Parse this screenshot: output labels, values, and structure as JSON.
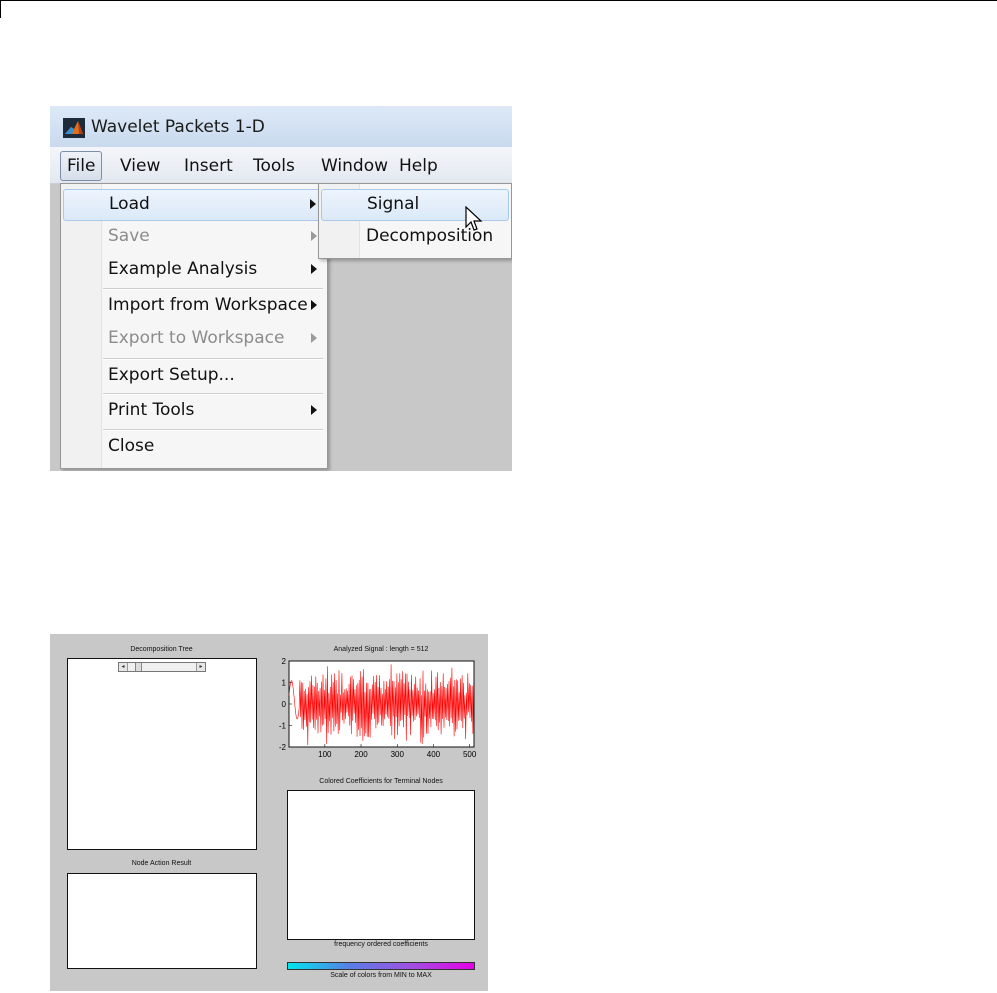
{
  "window": {
    "title": "Wavelet Packets 1-D",
    "app_icon": "matlab-icon"
  },
  "menubar": {
    "items": [
      "File",
      "View",
      "Insert",
      "Tools",
      "Window",
      "Help"
    ],
    "active": "File"
  },
  "file_menu": {
    "items": [
      {
        "label": "Load",
        "submenu": true,
        "enabled": true,
        "highlighted": true
      },
      {
        "label": "Save",
        "submenu": true,
        "enabled": false
      },
      {
        "label": "Example Analysis",
        "submenu": true,
        "enabled": true
      },
      {
        "label": "Import from Workspace",
        "submenu": true,
        "enabled": true
      },
      {
        "label": "Export to Workspace",
        "submenu": true,
        "enabled": false
      },
      {
        "label": "Export Setup...",
        "submenu": false,
        "enabled": true
      },
      {
        "label": "Print Tools",
        "submenu": true,
        "enabled": true
      },
      {
        "label": "Close",
        "submenu": false,
        "enabled": true
      }
    ]
  },
  "load_submenu": {
    "items": [
      {
        "label": "Signal",
        "highlighted": true
      },
      {
        "label": "Decomposition",
        "highlighted": false
      }
    ]
  },
  "figure": {
    "tree_title": "Decomposition Tree",
    "node_title": "Node Action Result",
    "signal_title": "Analyzed Signal : length = 512",
    "coeff_title": "Colored Coefficients for Terminal Nodes",
    "coeff_xlabel": "frequency ordered coefficients",
    "colorbar_label": "Scale of colors from MIN to MAX",
    "colors": {
      "signal": "#ff0000",
      "colorbar_start": "#00e6ee",
      "colorbar_end": "#e600e8"
    }
  },
  "chart_data": {
    "type": "line",
    "title": "Analyzed Signal : length = 512",
    "xlim": [
      1,
      512
    ],
    "ylim": [
      -2,
      2
    ],
    "xticks": [
      100,
      200,
      300,
      400,
      500
    ],
    "yticks": [
      2,
      1,
      0,
      -1,
      -2
    ],
    "grid": false,
    "series": [
      {
        "color": "#ff0000",
        "length": 512,
        "y_sample": [
          0.1,
          0.6,
          0.9,
          1.2,
          0.4,
          -0.4,
          -0.6,
          0.8,
          1.4,
          -1.6,
          1.8,
          -1.9,
          1.7,
          -1.8,
          1.9,
          -1.5,
          1.6,
          -1.9,
          1.8,
          -1.7
        ]
      }
    ]
  }
}
